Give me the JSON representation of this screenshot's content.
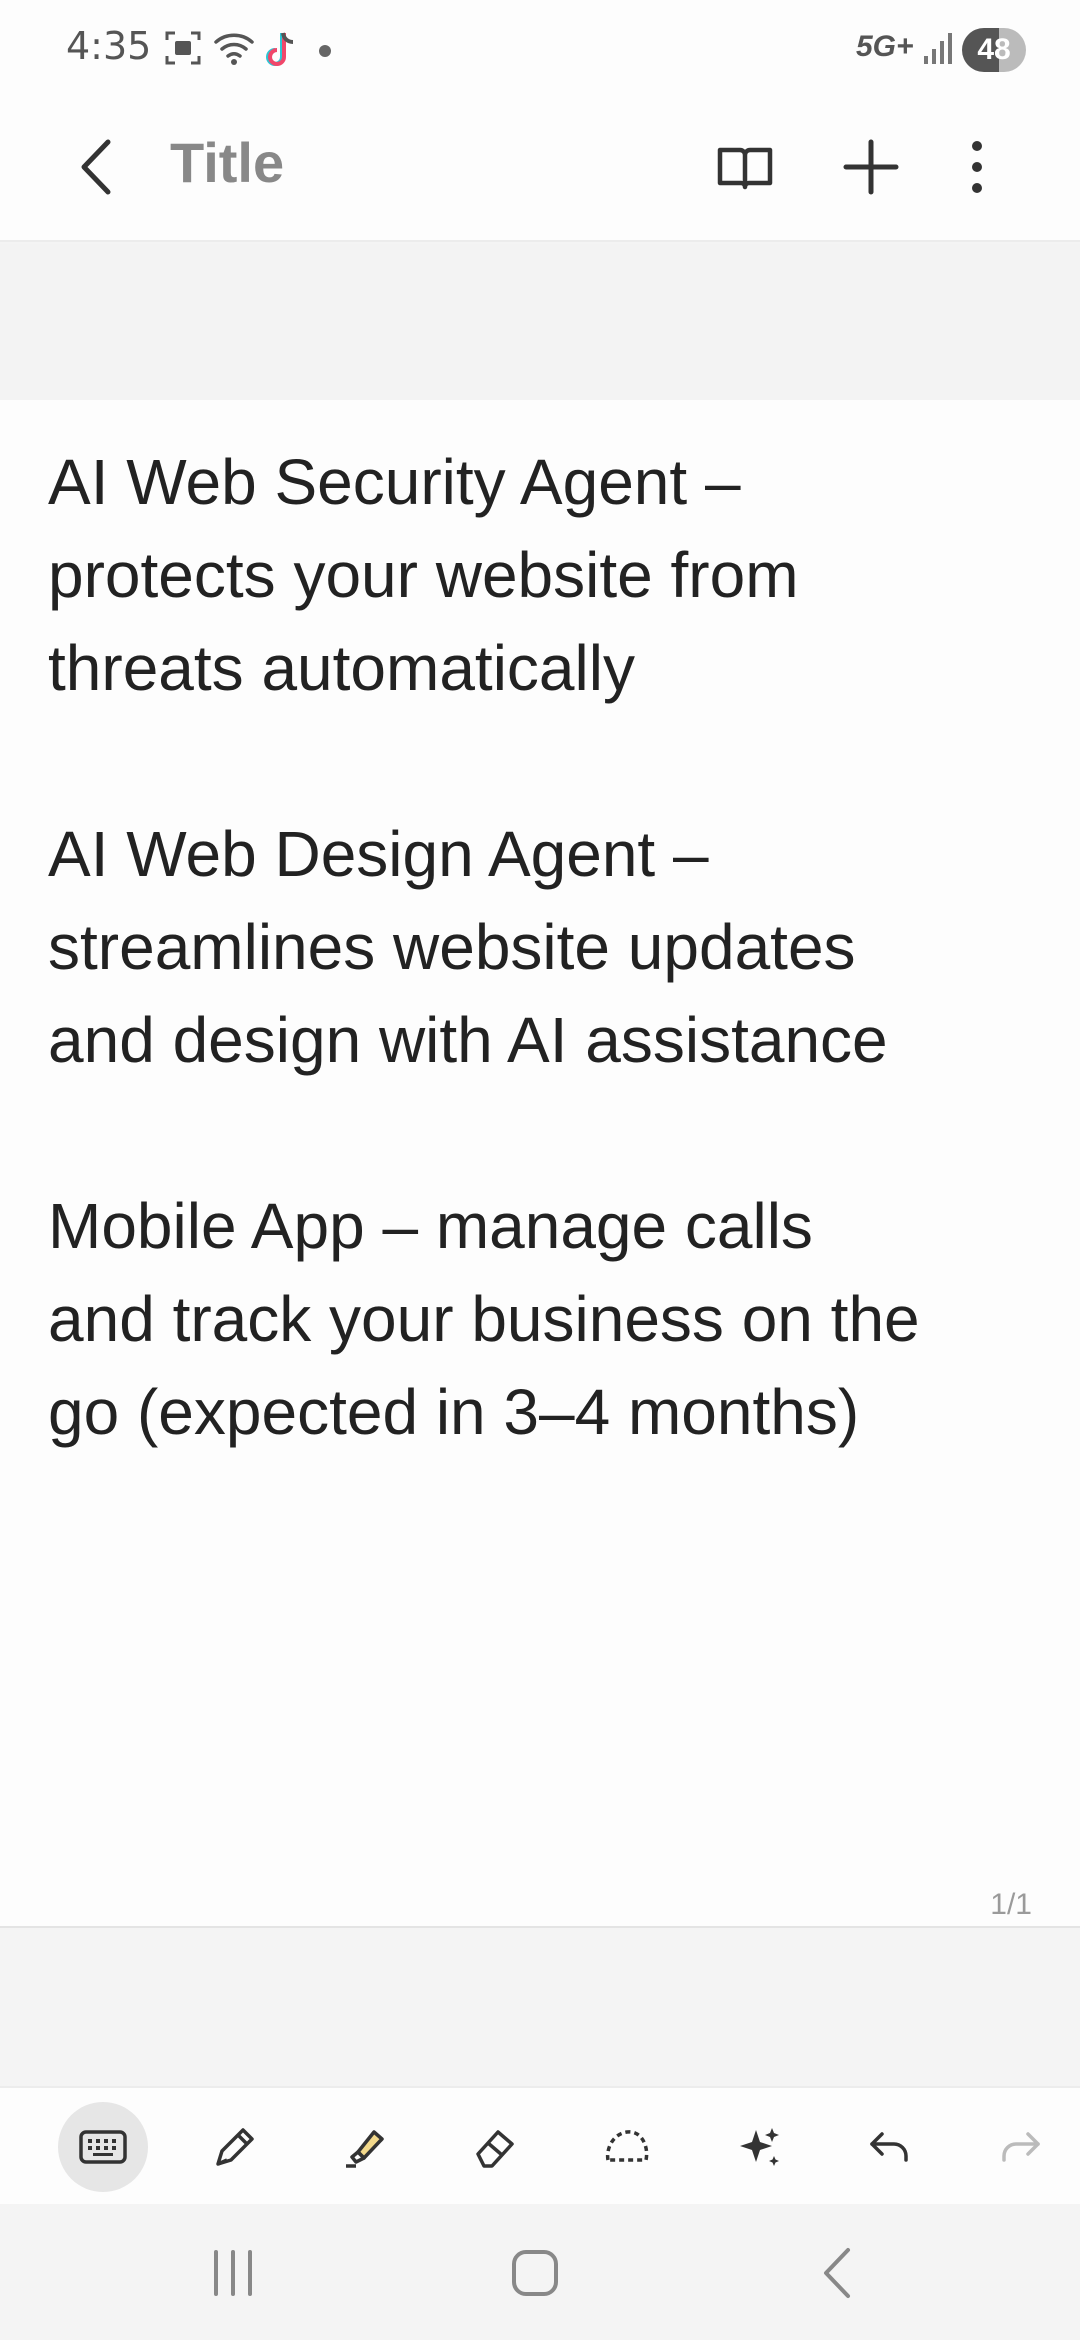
{
  "status_bar": {
    "time": "4:35",
    "network": "5G+",
    "battery": "48",
    "icons": [
      "screenshot-icon",
      "wifi-icon",
      "tiktok-icon",
      "notification-dot-icon",
      "signal-icon"
    ]
  },
  "app_bar": {
    "title": "Title",
    "icons": [
      "back-arrow-icon",
      "book-view-icon",
      "plus-icon",
      "more-vert-icon"
    ]
  },
  "note": {
    "body": "AI Web Security Agent –\nprotects your website from\nthreats automatically\n\nAI Web Design Agent –\nstreamlines website updates\nand design with AI assistance\n\nMobile App – manage calls\nand track your business on the\ngo (expected in 3–4 months)",
    "page_indicator": "1/1"
  },
  "toolbar": {
    "tools": [
      "keyboard-icon",
      "pen-icon",
      "highlighter-icon",
      "eraser-icon",
      "lasso-icon",
      "ai-sparkle-icon",
      "undo-icon",
      "redo-icon"
    ],
    "active_tool": "keyboard-icon"
  },
  "nav_bar": {
    "icons": [
      "recents-icon",
      "home-icon",
      "back-icon"
    ]
  },
  "colors": {
    "background": "#f4f4f4",
    "page": "#fdfdfd",
    "text": "#222222",
    "highlighter": "#f3d98b"
  }
}
